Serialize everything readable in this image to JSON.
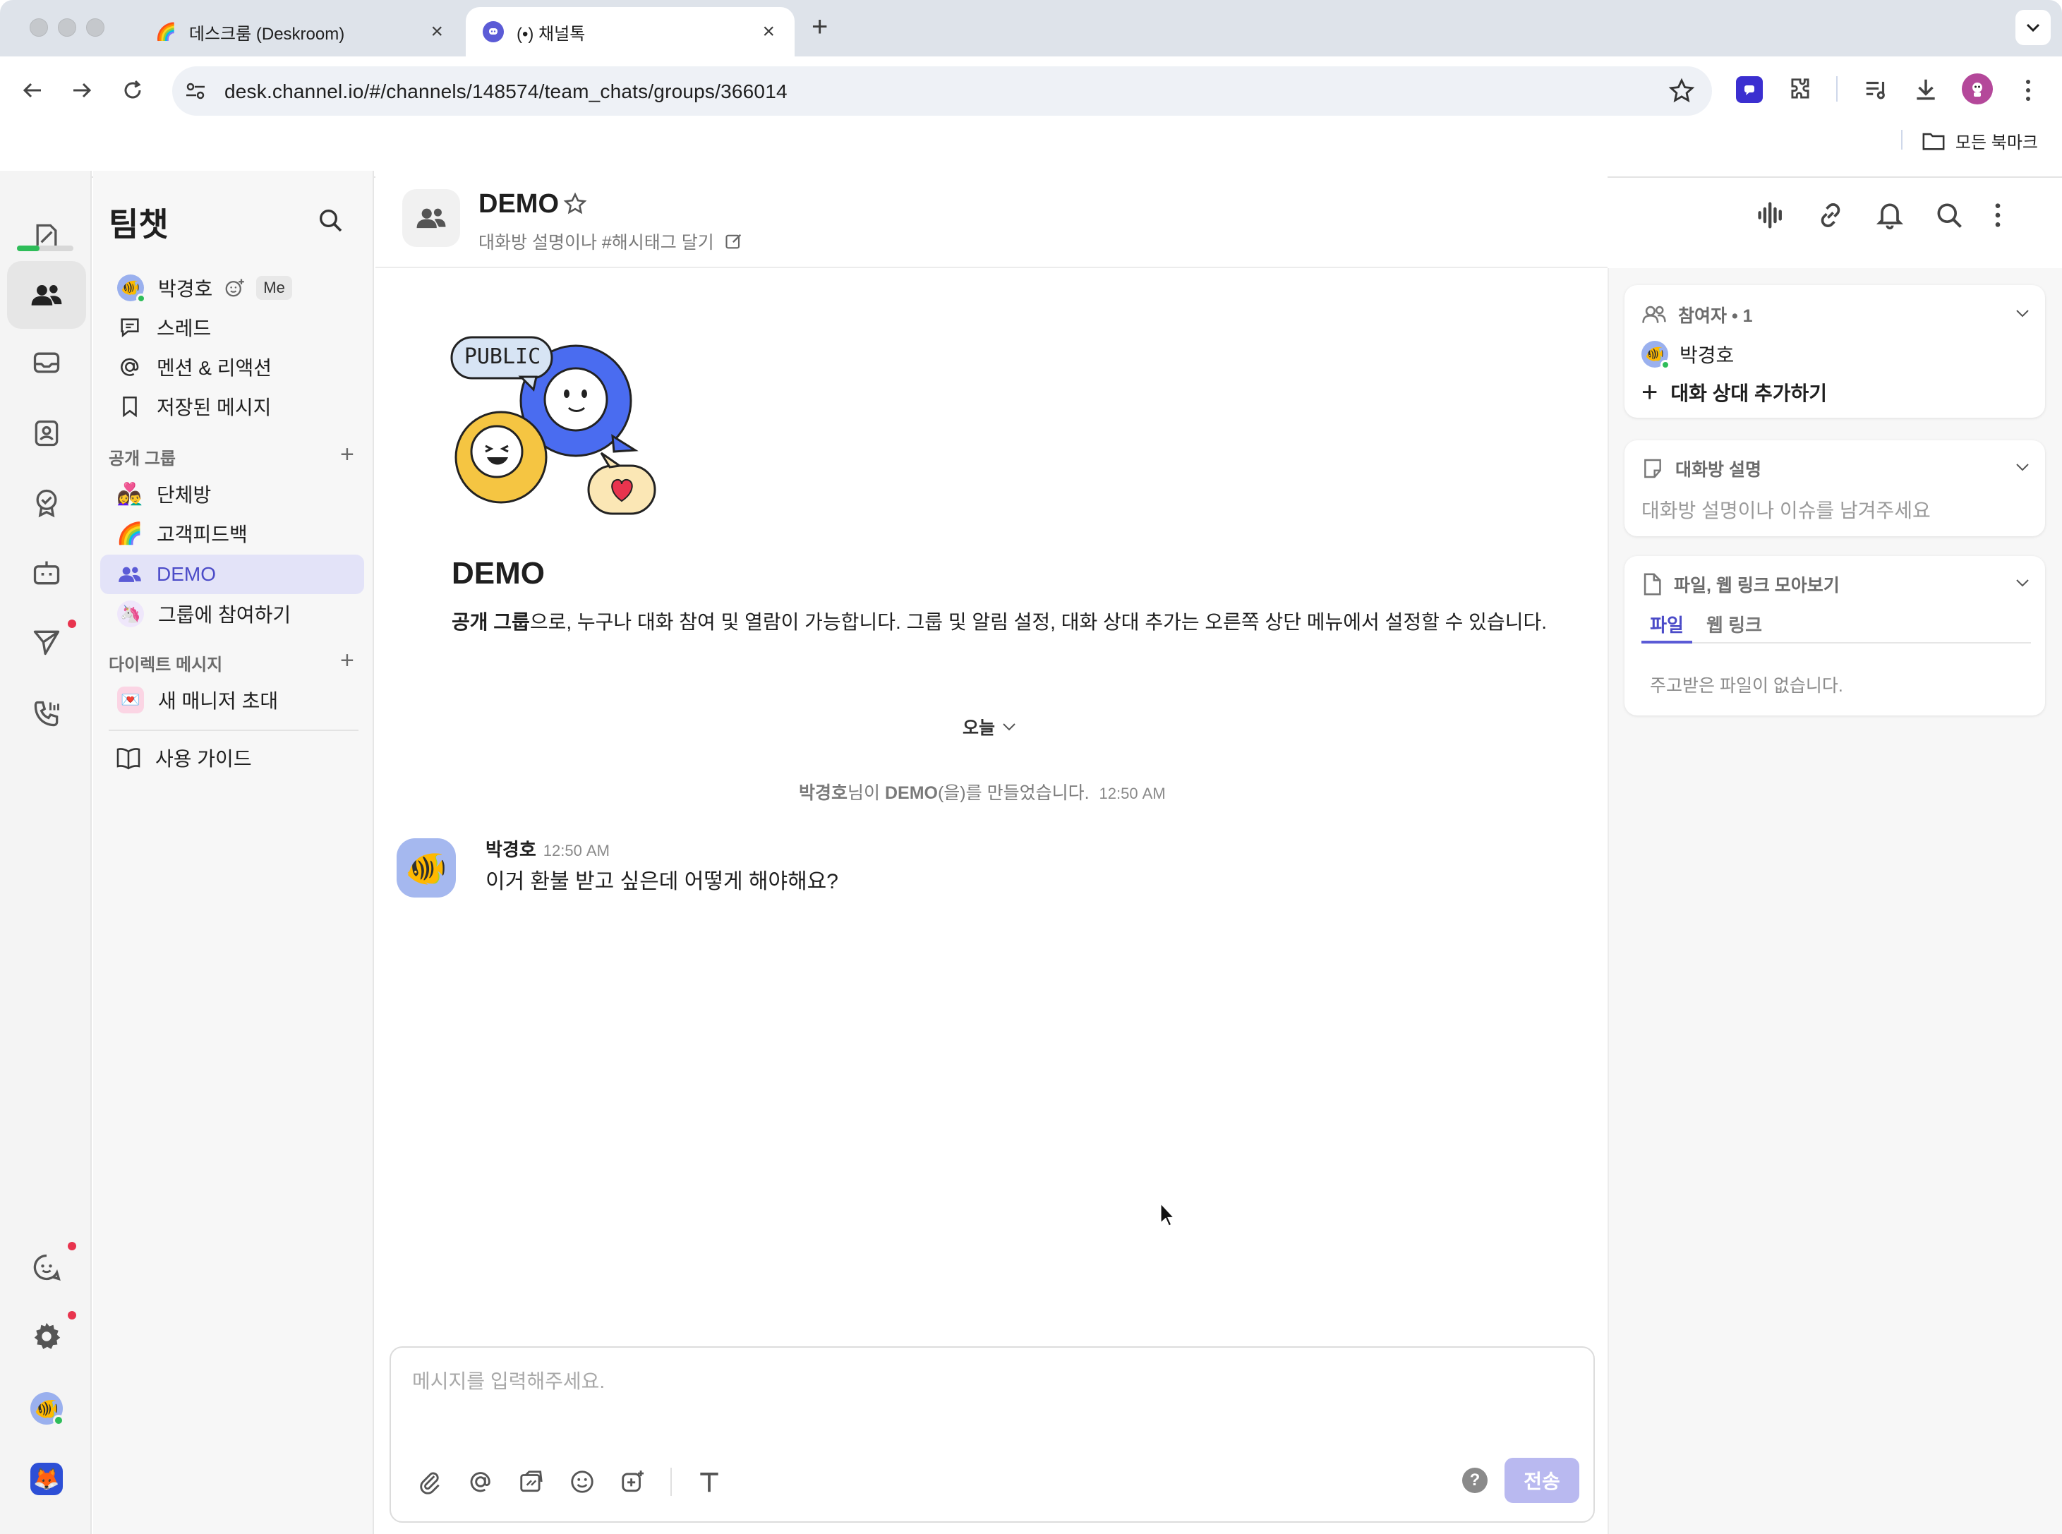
{
  "browser": {
    "tabs": [
      {
        "title": "데스크룸 (Deskroom)"
      },
      {
        "title": "(•) 채널톡"
      }
    ],
    "url": "desk.channel.io/#/channels/148574/team_chats/groups/366014",
    "bookmarks_label": "모든 북마크"
  },
  "sidebar": {
    "title": "팀챗",
    "user_name": "박경호",
    "me_badge": "Me",
    "nav": [
      "스레드",
      "멘션 & 리액션",
      "저장된 메시지"
    ],
    "public_groups_label": "공개 그룹",
    "groups": [
      {
        "emoji": "👩‍❤️‍👨",
        "name": "단체방"
      },
      {
        "emoji": "🌈",
        "name": "고객피드백"
      },
      {
        "emoji": "",
        "name": "DEMO"
      },
      {
        "emoji": "🦄",
        "name": "그룹에 참여하기"
      }
    ],
    "dm_label": "다이렉트 메시지",
    "dm_items": [
      {
        "emoji": "💌",
        "name": "새 매니저 초대"
      }
    ],
    "guide_label": "사용 가이드"
  },
  "header": {
    "title": "DEMO",
    "description_placeholder": "대화방 설명이나 #해시태그 달기"
  },
  "intro": {
    "badge_text": "PUBLIC",
    "title": "DEMO",
    "desc_bold": "공개 그룹",
    "desc_rest": "으로, 누구나 대화 참여 및 열람이 가능합니다. 그룹 및 알림 설정, 대화 상대 추가는 오른쪽 상단 메뉴에서 설정할 수 있습니다."
  },
  "timeline": {
    "date_divider": "오늘",
    "system_user": "박경호",
    "system_mid": "님이 ",
    "system_room": "DEMO",
    "system_rest": "(을)를 만들었습니다.",
    "system_time": "12:50 AM"
  },
  "messages": [
    {
      "author": "박경호",
      "time": "12:50 AM",
      "text": "이거 환불 받고 싶은데 어떻게 해야해요?"
    }
  ],
  "composer": {
    "placeholder": "메시지를 입력해주세요.",
    "send_label": "전송",
    "help_label": "?"
  },
  "right_panel": {
    "participants_title": "참여자 • 1",
    "participant_name": "박경호",
    "add_member_label": "대화 상대 추가하기",
    "room_desc_title": "대화방 설명",
    "room_desc_placeholder": "대화방 설명이나 이슈를 남겨주세요",
    "files_title": "파일, 웹 링크 모아보기",
    "file_tabs": [
      "파일",
      "웹 링크"
    ],
    "files_empty": "주고받은 파일이 없습니다."
  },
  "colors": {
    "accent": "#5b5bd6",
    "online": "#2ebd59",
    "badge": "#e8344e"
  }
}
